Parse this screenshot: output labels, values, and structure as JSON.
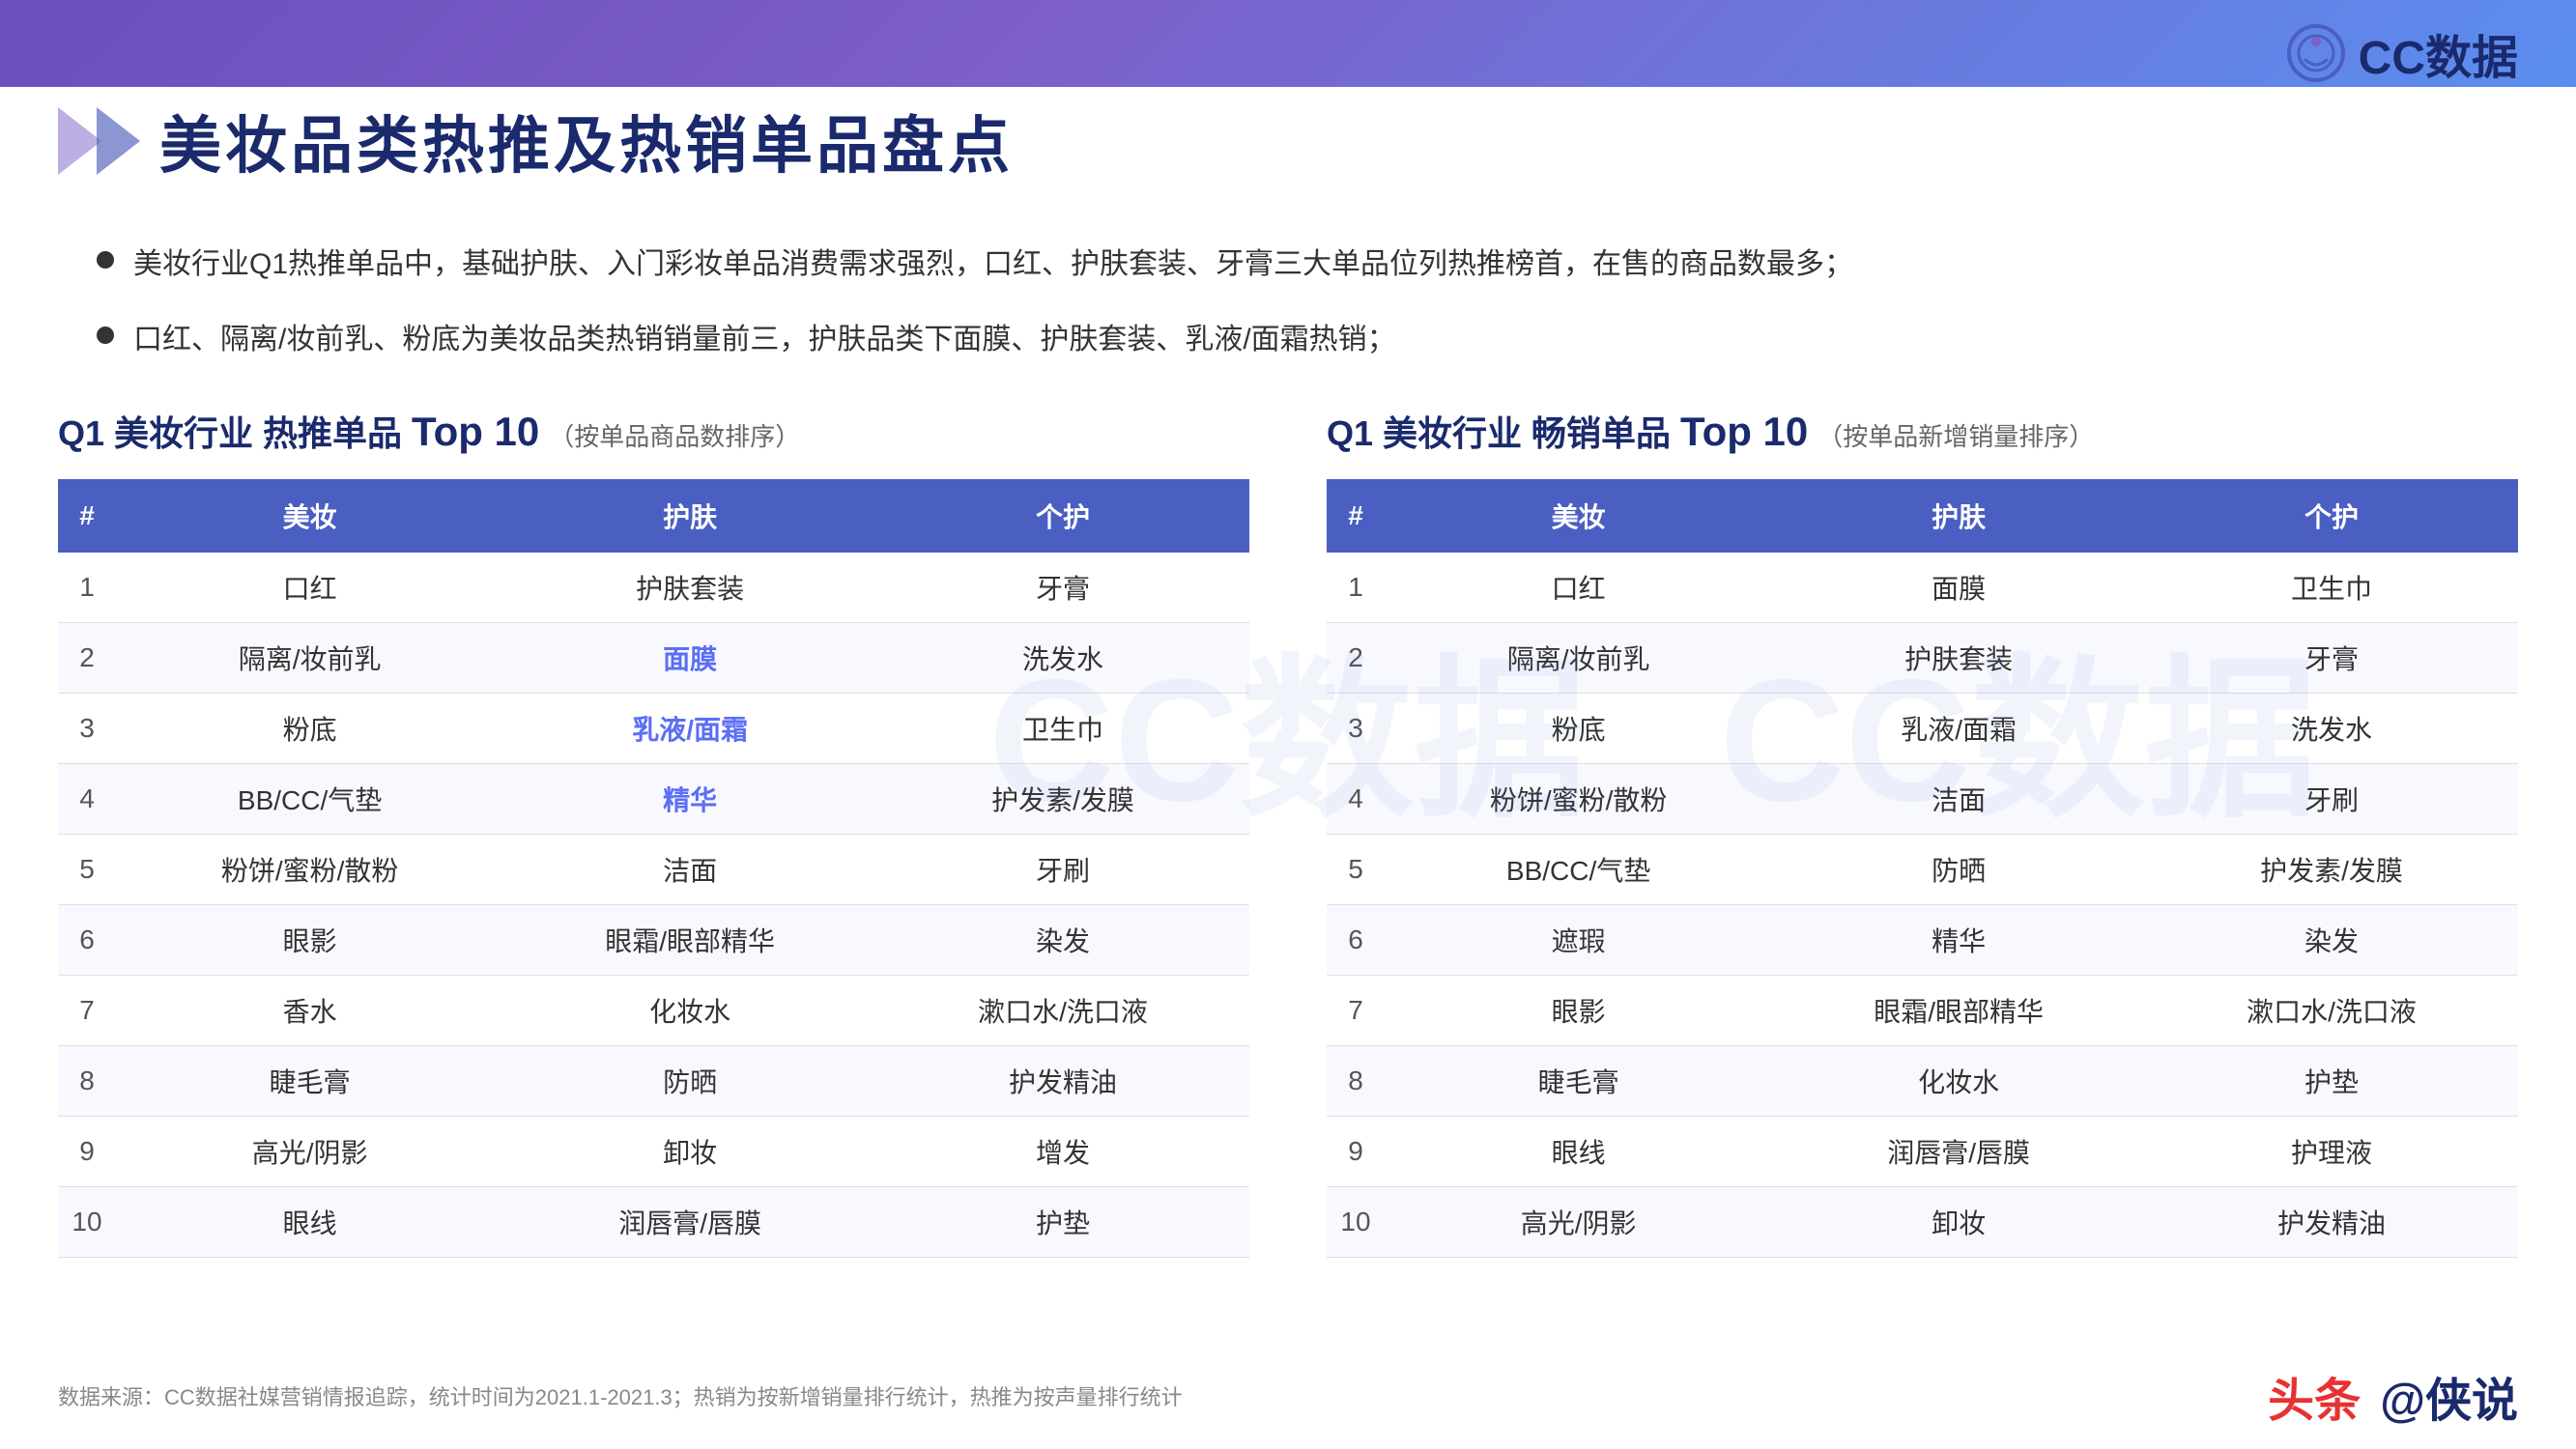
{
  "header": {
    "background": "gradient"
  },
  "logo": {
    "text": "CC数据",
    "icon": "CC"
  },
  "title": {
    "text": "美妆品类热推及热销单品盘点"
  },
  "bullets": [
    "美妆行业Q1热推单品中，基础护肤、入门彩妆单品消费需求强烈，口红、护肤套装、牙膏三大单品位列热推榜首，在售的商品数最多；",
    "口红、隔离/妆前乳、粉底为美妆品类热销销量前三，护肤品类下面膜、护肤套装、乳液/面霜热销；"
  ],
  "table1": {
    "title_prefix": "Q1 美妆行业 热推单品",
    "top_label": "Top",
    "top_number": "10",
    "subtitle": "（按单品商品数排序）",
    "headers": [
      "#",
      "美妆",
      "护肤",
      "个护"
    ],
    "rows": [
      {
        "rank": "1",
        "makeup": "口红",
        "skincare": "护肤套装",
        "personal": "牙膏"
      },
      {
        "rank": "2",
        "makeup": "隔离/妆前乳",
        "skincare": "面膜",
        "personal": "洗发水",
        "skincare_highlight": true
      },
      {
        "rank": "3",
        "makeup": "粉底",
        "skincare": "乳液/面霜",
        "personal": "卫生巾",
        "skincare_highlight": true
      },
      {
        "rank": "4",
        "makeup": "BB/CC/气垫",
        "skincare": "精华",
        "personal": "护发素/发膜",
        "skincare_highlight": true
      },
      {
        "rank": "5",
        "makeup": "粉饼/蜜粉/散粉",
        "skincare": "洁面",
        "personal": "牙刷"
      },
      {
        "rank": "6",
        "makeup": "眼影",
        "skincare": "眼霜/眼部精华",
        "personal": "染发"
      },
      {
        "rank": "7",
        "makeup": "香水",
        "skincare": "化妆水",
        "personal": "漱口水/洗口液"
      },
      {
        "rank": "8",
        "makeup": "睫毛膏",
        "skincare": "防晒",
        "personal": "护发精油"
      },
      {
        "rank": "9",
        "makeup": "高光/阴影",
        "skincare": "卸妆",
        "personal": "增发"
      },
      {
        "rank": "10",
        "makeup": "眼线",
        "skincare": "润唇膏/唇膜",
        "personal": "护垫"
      }
    ]
  },
  "table2": {
    "title_prefix": "Q1 美妆行业 畅销单品",
    "top_label": "Top",
    "top_number": "10",
    "subtitle": "（按单品新增销量排序）",
    "headers": [
      "#",
      "美妆",
      "护肤",
      "个护"
    ],
    "rows": [
      {
        "rank": "1",
        "makeup": "口红",
        "skincare": "面膜",
        "personal": "卫生巾"
      },
      {
        "rank": "2",
        "makeup": "隔离/妆前乳",
        "skincare": "护肤套装",
        "personal": "牙膏"
      },
      {
        "rank": "3",
        "makeup": "粉底",
        "skincare": "乳液/面霜",
        "personal": "洗发水"
      },
      {
        "rank": "4",
        "makeup": "粉饼/蜜粉/散粉",
        "skincare": "洁面",
        "personal": "牙刷"
      },
      {
        "rank": "5",
        "makeup": "BB/CC/气垫",
        "skincare": "防晒",
        "personal": "护发素/发膜"
      },
      {
        "rank": "6",
        "makeup": "遮瑕",
        "skincare": "精华",
        "personal": "染发"
      },
      {
        "rank": "7",
        "makeup": "眼影",
        "skincare": "眼霜/眼部精华",
        "personal": "漱口水/洗口液"
      },
      {
        "rank": "8",
        "makeup": "睫毛膏",
        "skincare": "化妆水",
        "personal": "护垫"
      },
      {
        "rank": "9",
        "makeup": "眼线",
        "skincare": "润唇膏/唇膜",
        "personal": "护理液"
      },
      {
        "rank": "10",
        "makeup": "高光/阴影",
        "skincare": "卸妆",
        "personal": "护发精油"
      }
    ]
  },
  "watermark": "CC数据",
  "footer": {
    "source": "数据来源：CC数据社媒营销情报追踪，统计时间为2021.1-2021.3；热销为按新增销量排行统计，热推为按声量排行统计",
    "brand1": "头条",
    "brand2": "@侠说"
  }
}
